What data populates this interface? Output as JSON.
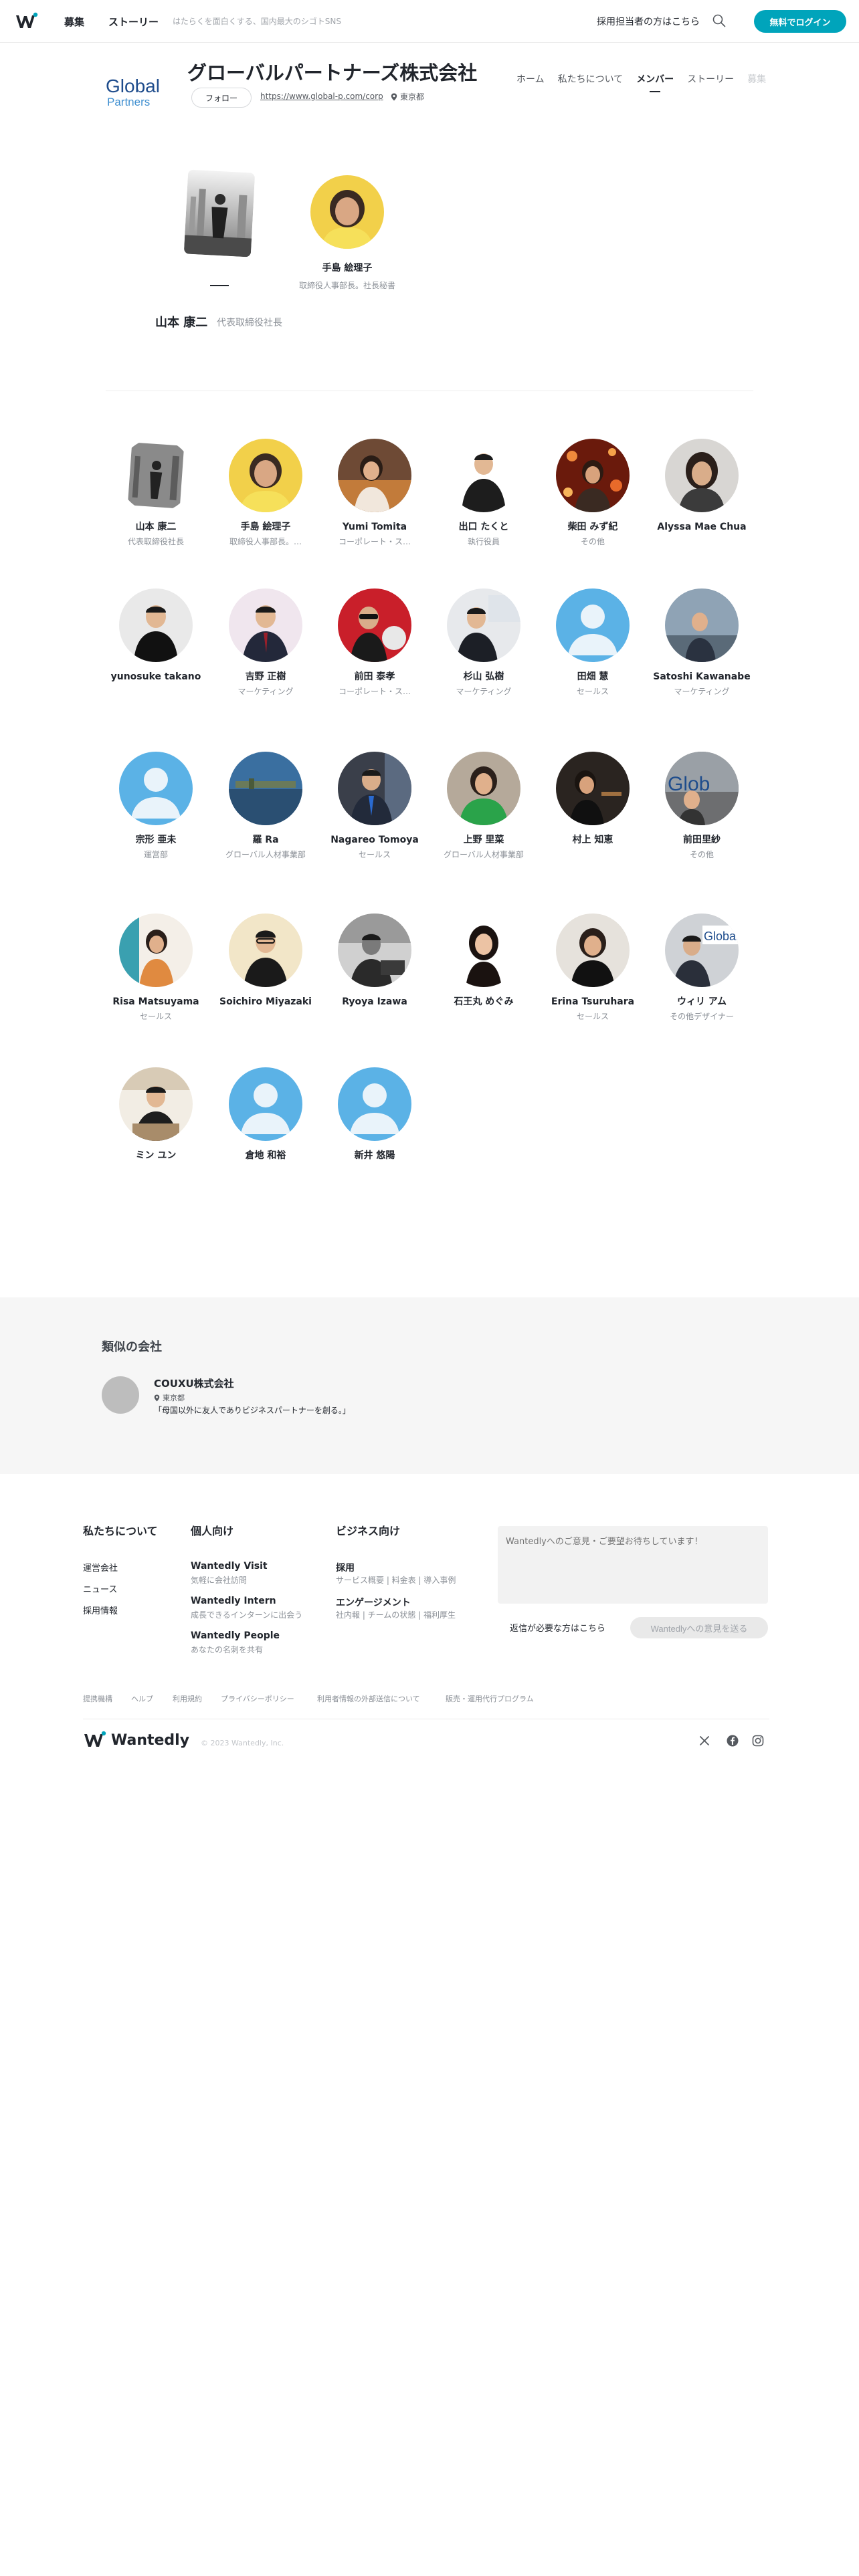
{
  "nav": {
    "recruit": "募集",
    "stories": "ストーリー",
    "tagline": "はたらくを面白くする、国内最大のシゴトSNS",
    "recruiter_link": "採用担当者の方はこちら",
    "login": "無料でログイン"
  },
  "company": {
    "name": "グローバルパートナーズ株式会社",
    "follow": "フォロー",
    "url": "https://www.global-p.com/corp",
    "location": "東京都",
    "logo_text_1": "Global",
    "logo_text_2": "Partners",
    "tabs": [
      "ホーム",
      "私たちについて",
      "メンバー",
      "ストーリー",
      "募集"
    ]
  },
  "featured": {
    "name": "山本 康二",
    "title": "代表取締役社長",
    "second_name": "手島 絵理子",
    "second_title": "取締役人事部長。社長秘書"
  },
  "members": [
    {
      "name": "山本 康二",
      "role": "代表取締役社長"
    },
    {
      "name": "手島 絵理子",
      "role": "取締役人事部長。…"
    },
    {
      "name": "Yumi Tomita",
      "role": "コーポレート・ス…"
    },
    {
      "name": "出口 たくと",
      "role": "執行役員"
    },
    {
      "name": "柴田 みず紀",
      "role": "その他"
    },
    {
      "name": "Alyssa Mae Chua",
      "role": ""
    },
    {
      "name": "yunosuke takano",
      "role": ""
    },
    {
      "name": "吉野 正樹",
      "role": "マーケティング"
    },
    {
      "name": "前田 泰孝",
      "role": "コーポレート・ス…"
    },
    {
      "name": "杉山 弘樹",
      "role": "マーケティング"
    },
    {
      "name": "田畑 慧",
      "role": "セールス"
    },
    {
      "name": "Satoshi Kawanabe",
      "role": "マーケティング"
    },
    {
      "name": "宗形 亜未",
      "role": "運営部"
    },
    {
      "name": "羅 Ra",
      "role": "グローバル人材事業部"
    },
    {
      "name": "Nagareo Tomoya",
      "role": "セールス"
    },
    {
      "name": "上野 里菜",
      "role": "グローバル人材事業部"
    },
    {
      "name": "村上 知恵",
      "role": ""
    },
    {
      "name": "前田里紗",
      "role": "その他"
    },
    {
      "name": "Risa Matsuyama",
      "role": "セールス"
    },
    {
      "name": "Soichiro Miyazaki",
      "role": ""
    },
    {
      "name": "Ryoya Izawa",
      "role": ""
    },
    {
      "name": "石王丸 めぐみ",
      "role": ""
    },
    {
      "name": "Erina Tsuruhara",
      "role": "セールス"
    },
    {
      "name": "ウィリ アム",
      "role": "その他デザイナー"
    },
    {
      "name": "ミン ユン",
      "role": ""
    },
    {
      "name": "倉地 和裕",
      "role": ""
    },
    {
      "name": "新井 悠陽",
      "role": ""
    }
  ],
  "similar": {
    "title": "類似の会社",
    "name": "COUXU株式会社",
    "location": "東京都",
    "description": "「母国以外に友人でありビジネスパートナーを創る。」"
  },
  "footer": {
    "about": {
      "title": "私たちについて",
      "links": [
        "運営会社",
        "ニュース",
        "採用情報"
      ]
    },
    "personal": {
      "title": "個人向け",
      "items": [
        {
          "name": "Wantedly Visit",
          "desc": "気軽に会社訪問"
        },
        {
          "name": "Wantedly Intern",
          "desc": "成長できるインターンに出会う"
        },
        {
          "name": "Wantedly People",
          "desc": "あなたの名刺を共有"
        }
      ]
    },
    "business": {
      "title": "ビジネス向け",
      "items": [
        {
          "name": "採用",
          "desc": "サービス概要 | 料金表 | 導入事例"
        },
        {
          "name": "エンゲージメント",
          "desc": "社内報 | チームの状態 | 福利厚生"
        }
      ]
    },
    "feedback_placeholder": "Wantedlyへのご意見・ご要望お待ちしています！",
    "reply_link": "返信が必要な方はこちら",
    "send_button": "Wantedlyへの意見を送る",
    "small_links": [
      "提携機構",
      "ヘルプ",
      "利用規約",
      "プライバシーポリシー",
      "利用者情報の外部送信について",
      "販売・運用代行プログラム"
    ],
    "brand": "Wantedly",
    "copyright": "© 2023 Wantedly, Inc."
  },
  "colors": {
    "accent": "#00a4bb",
    "text": "#21252c",
    "muted": "#8b9097"
  }
}
